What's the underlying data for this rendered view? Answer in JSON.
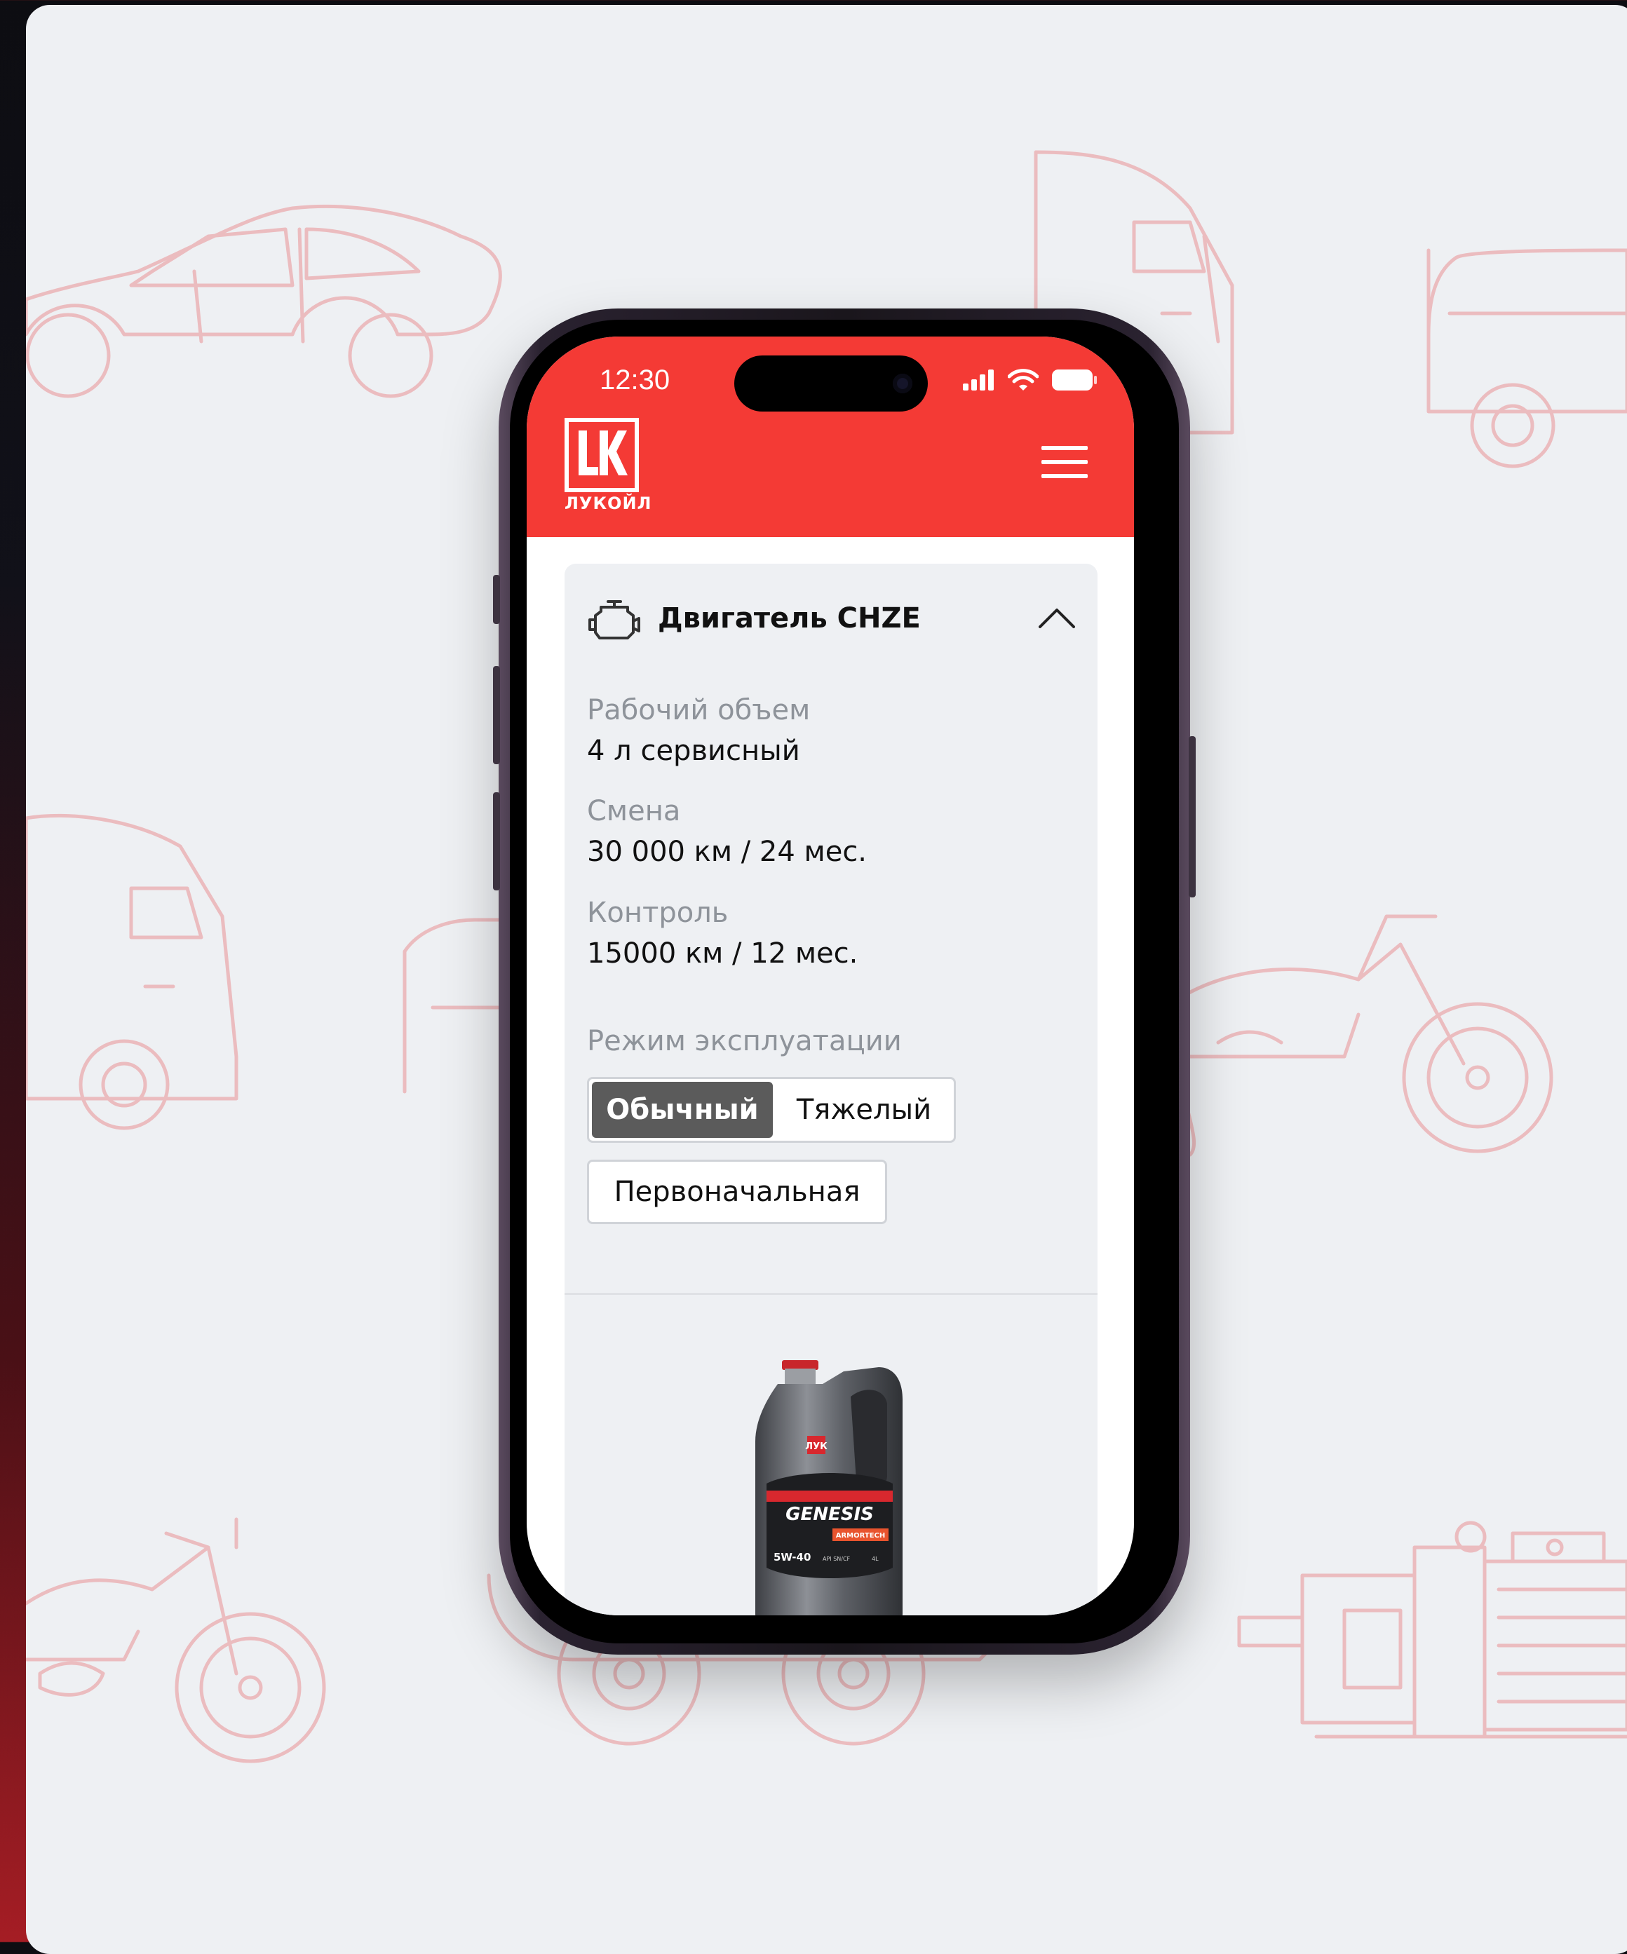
{
  "status_bar": {
    "time": "12:30"
  },
  "header": {
    "logo_text": "ЛУКОЙЛ",
    "brand_color": "#f43a35"
  },
  "engine": {
    "title": "Двигатель CHZE",
    "fields": [
      {
        "label": "Рабочий объем",
        "value": "4 л сервисный"
      },
      {
        "label": "Смена",
        "value": "30 000 км / 24 мес."
      },
      {
        "label": "Контроль",
        "value": "15000 км / 12 мес."
      }
    ],
    "mode": {
      "label": "Режим эксплуатации",
      "options": [
        "Обычный",
        "Тяжелый"
      ],
      "selected": "Обычный"
    },
    "initial_button": "Первоначальная"
  },
  "product": {
    "brand_mark": "ЛУК",
    "name": "GENESIS",
    "sub": "ARMORTECH",
    "viscosity": "5W-40",
    "spec": "API SN/CF",
    "volume": "4L"
  }
}
